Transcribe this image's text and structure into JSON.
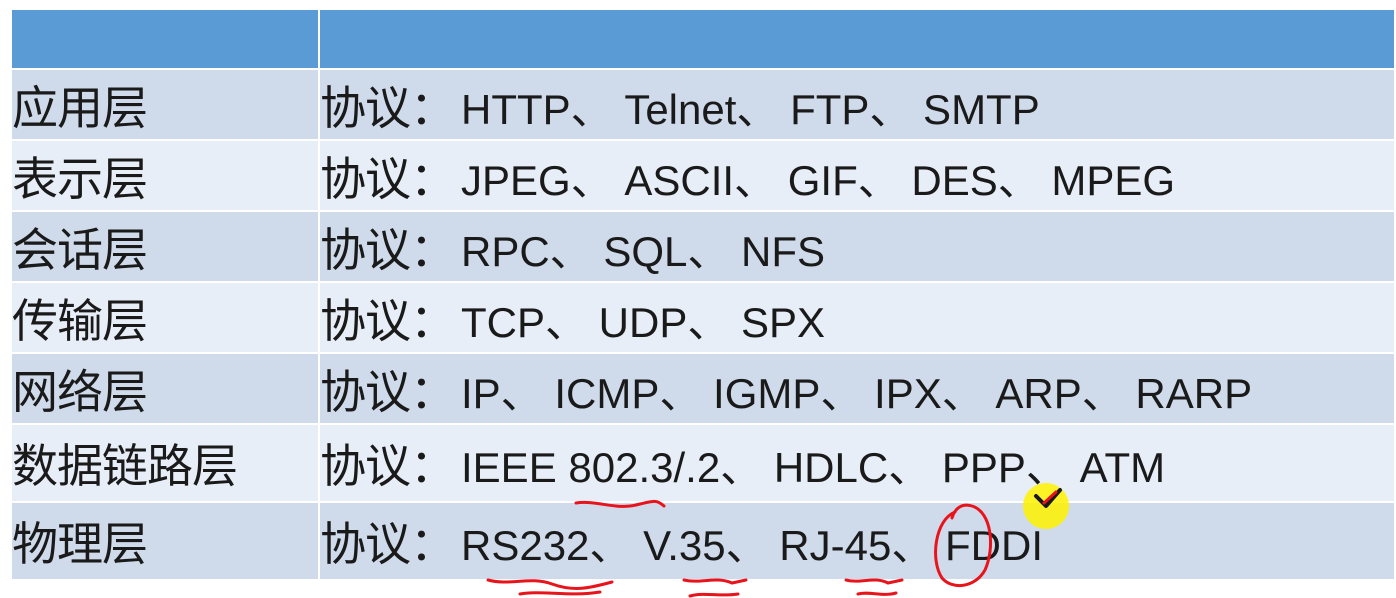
{
  "rows": [
    {
      "layer": "应用层",
      "key": "协议：",
      "protocols": "HTTP、 Telnet、 FTP、 SMTP"
    },
    {
      "layer": "表示层",
      "key": "协议：",
      "protocols": "JPEG、 ASCII、 GIF、 DES、 MPEG"
    },
    {
      "layer": "会话层",
      "key": "协议：",
      "protocols": "RPC、 SQL、 NFS"
    },
    {
      "layer": "传输层",
      "key": "协议：",
      "protocols": "TCP、 UDP、 SPX"
    },
    {
      "layer": "网络层",
      "key": "协议：",
      "protocols": "IP、 ICMP、 IGMP、 IPX、 ARP、 RARP"
    },
    {
      "layer": "数据链路层",
      "key": "协议：",
      "protocols": "IEEE 802.3/.2、 HDLC、 PPP、 ATM"
    },
    {
      "layer": "物理层",
      "key": "协议：",
      "protocols": "RS232、 V.35、 RJ-45、 FDDI"
    }
  ],
  "colors": {
    "header": "#5b9bd5",
    "row_dark": "#cfdbeb",
    "row_light": "#e8eef7",
    "annotation": "#e8141c",
    "cursor": "#fff200"
  }
}
